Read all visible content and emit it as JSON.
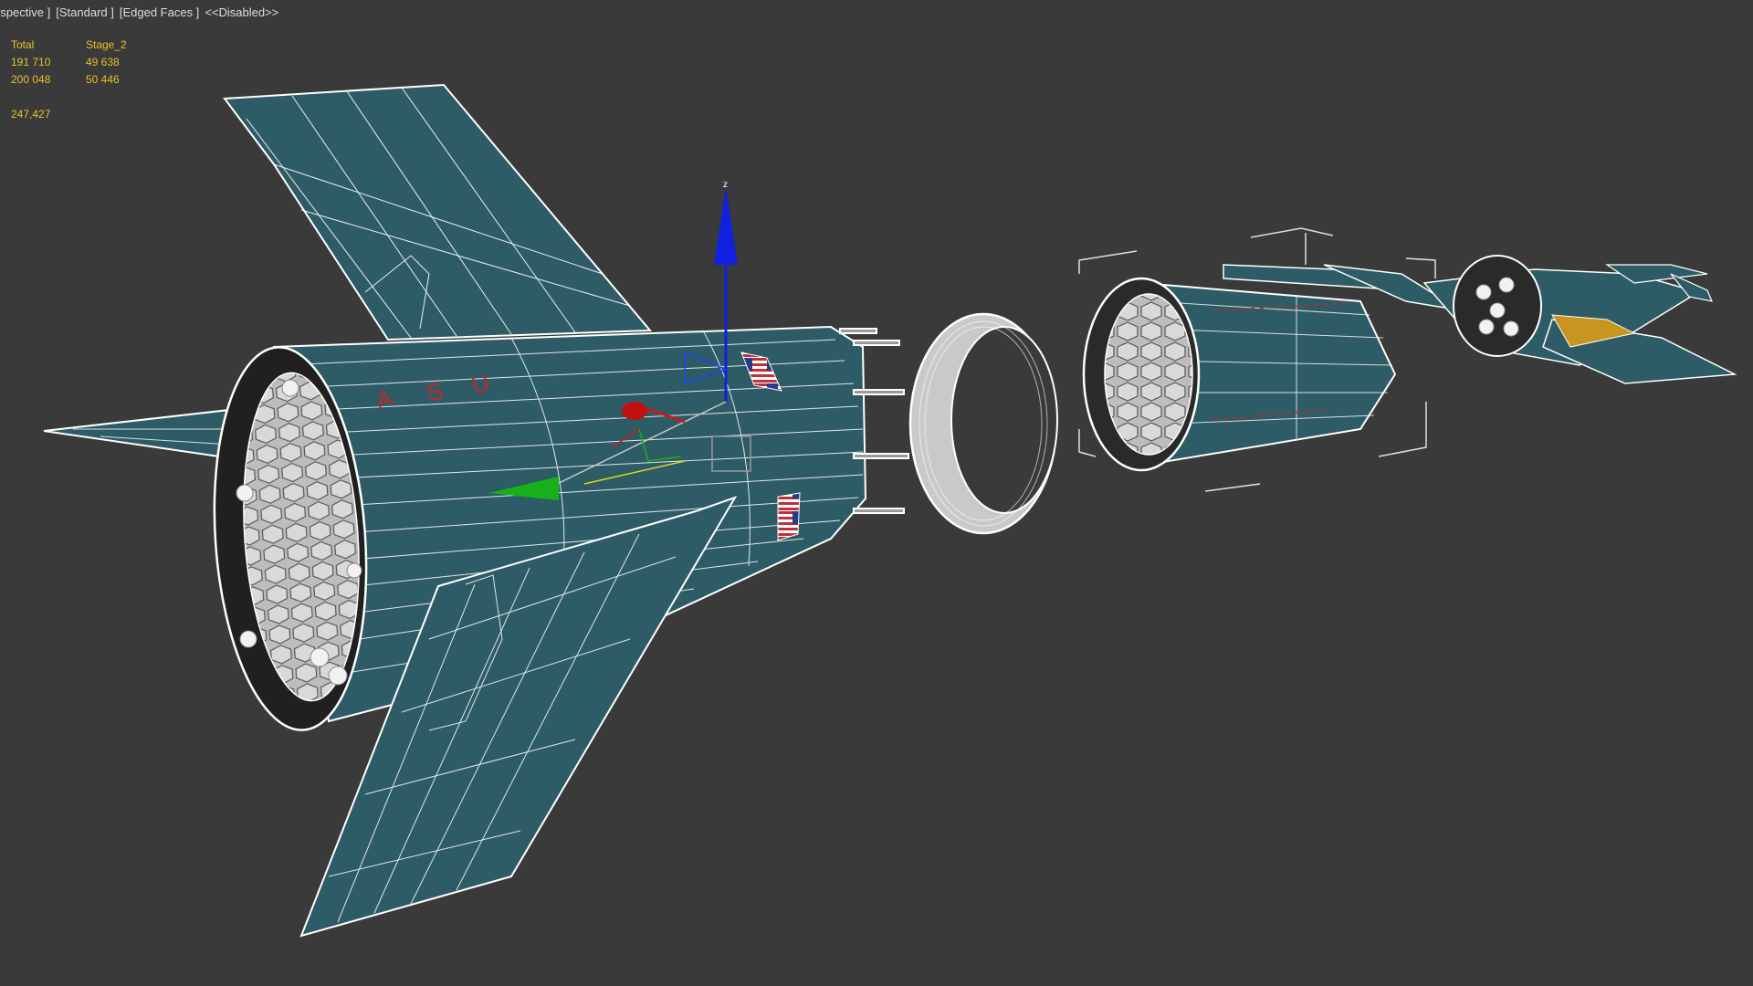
{
  "viewport": {
    "label_menu": {
      "view": "rspective ]",
      "shading": "[Standard ]",
      "edged": "[Edged Faces ]",
      "disabled": "<<Disabled>>"
    },
    "statistics": {
      "header": {
        "total": "Total",
        "selection": "Stage_2"
      },
      "polys": {
        "total": "191 710",
        "selection": "49 638"
      },
      "verts": {
        "total": "200 048",
        "selection": "50 446"
      },
      "fps": "247,427"
    },
    "decal_text": [
      "A",
      "S",
      "U"
    ],
    "gizmo_axis_label": "z",
    "colors": {
      "background": "#3a3a3a",
      "hull": "#2e5c66",
      "wire": "#ffffff",
      "stat_text": "#e6c229",
      "axis_x": "#d01818",
      "axis_y": "#18b018",
      "axis_z": "#1020e0"
    }
  }
}
